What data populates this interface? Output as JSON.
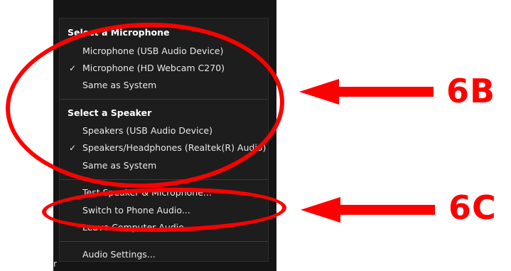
{
  "menu": {
    "microphone_header": "Select a Microphone",
    "microphones": [
      {
        "label": "Microphone (USB Audio Device)",
        "checked": false
      },
      {
        "label": "Microphone (HD Webcam C270)",
        "checked": true
      },
      {
        "label": "Same as System",
        "checked": false
      }
    ],
    "speaker_header": "Select a Speaker",
    "speakers": [
      {
        "label": "Speakers (USB Audio Device)",
        "checked": false
      },
      {
        "label": "Speakers/Headphones (Realtek(R) Audio)",
        "checked": true
      },
      {
        "label": "Same as System",
        "checked": false
      }
    ],
    "actions": {
      "test": "Test Speaker & Microphone...",
      "switch_phone": "Switch to Phone Audio...",
      "leave": "Leave Computer Audio",
      "settings": "Audio Settings..."
    },
    "check_glyph": "✓"
  },
  "fragment": "r",
  "annotations": {
    "label_6b": "6B",
    "label_6c": "6C",
    "color": "#ff0000"
  }
}
